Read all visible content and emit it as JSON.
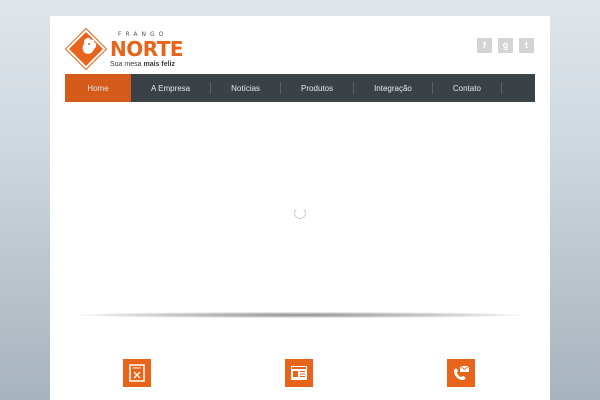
{
  "brand": {
    "top": "FRANGO",
    "name": "NORTE",
    "tagline_prefix": "Sua mesa",
    "tagline_bold": "mais feliz",
    "color": "#e8641b"
  },
  "social": [
    {
      "name": "facebook-icon",
      "glyph": "f"
    },
    {
      "name": "google-plus-icon",
      "glyph": "g"
    },
    {
      "name": "twitter-icon",
      "glyph": "t"
    }
  ],
  "nav": {
    "items": [
      {
        "label": "Home",
        "active": true
      },
      {
        "label": "A Empresa"
      },
      {
        "label": "Notícias"
      },
      {
        "label": "Produtos"
      },
      {
        "label": "Integração"
      },
      {
        "label": "Contato"
      }
    ],
    "active_color": "#d45b19",
    "bar_color": "#3a4147"
  },
  "features": [
    {
      "icon": "recipe-book-icon"
    },
    {
      "icon": "newspaper-icon"
    },
    {
      "icon": "phone-mail-icon"
    }
  ]
}
